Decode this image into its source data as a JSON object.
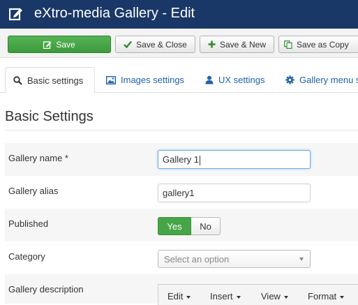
{
  "window": {
    "title": "eXtro-media Gallery - Edit"
  },
  "toolbar": {
    "save": "Save",
    "save_close": "Save & Close",
    "save_new": "Save & New",
    "save_copy": "Save as Copy"
  },
  "tabs": [
    {
      "label": "Basic settings",
      "icon": "search-icon",
      "active": true
    },
    {
      "label": "Images settings",
      "icon": "image-icon",
      "active": false
    },
    {
      "label": "UX settings",
      "icon": "user-icon",
      "active": false
    },
    {
      "label": "Gallery menu s",
      "icon": "gear-icon",
      "active": false
    }
  ],
  "section_title": "Basic Settings",
  "form": {
    "name_label": "Gallery name *",
    "name_value": "Gallery 1",
    "alias_label": "Gallery alias",
    "alias_value": "gallery1",
    "published_label": "Published",
    "published_yes": "Yes",
    "published_no": "No",
    "category_label": "Category",
    "category_placeholder": "Select an option",
    "description_label": "Gallery description"
  },
  "editor_menu": [
    "Edit",
    "Insert",
    "View",
    "Format"
  ],
  "colors": {
    "titlebar": "#1a3867",
    "save_button": "#46a546",
    "link": "#1f62a8",
    "active_toggle": "#46a546"
  }
}
